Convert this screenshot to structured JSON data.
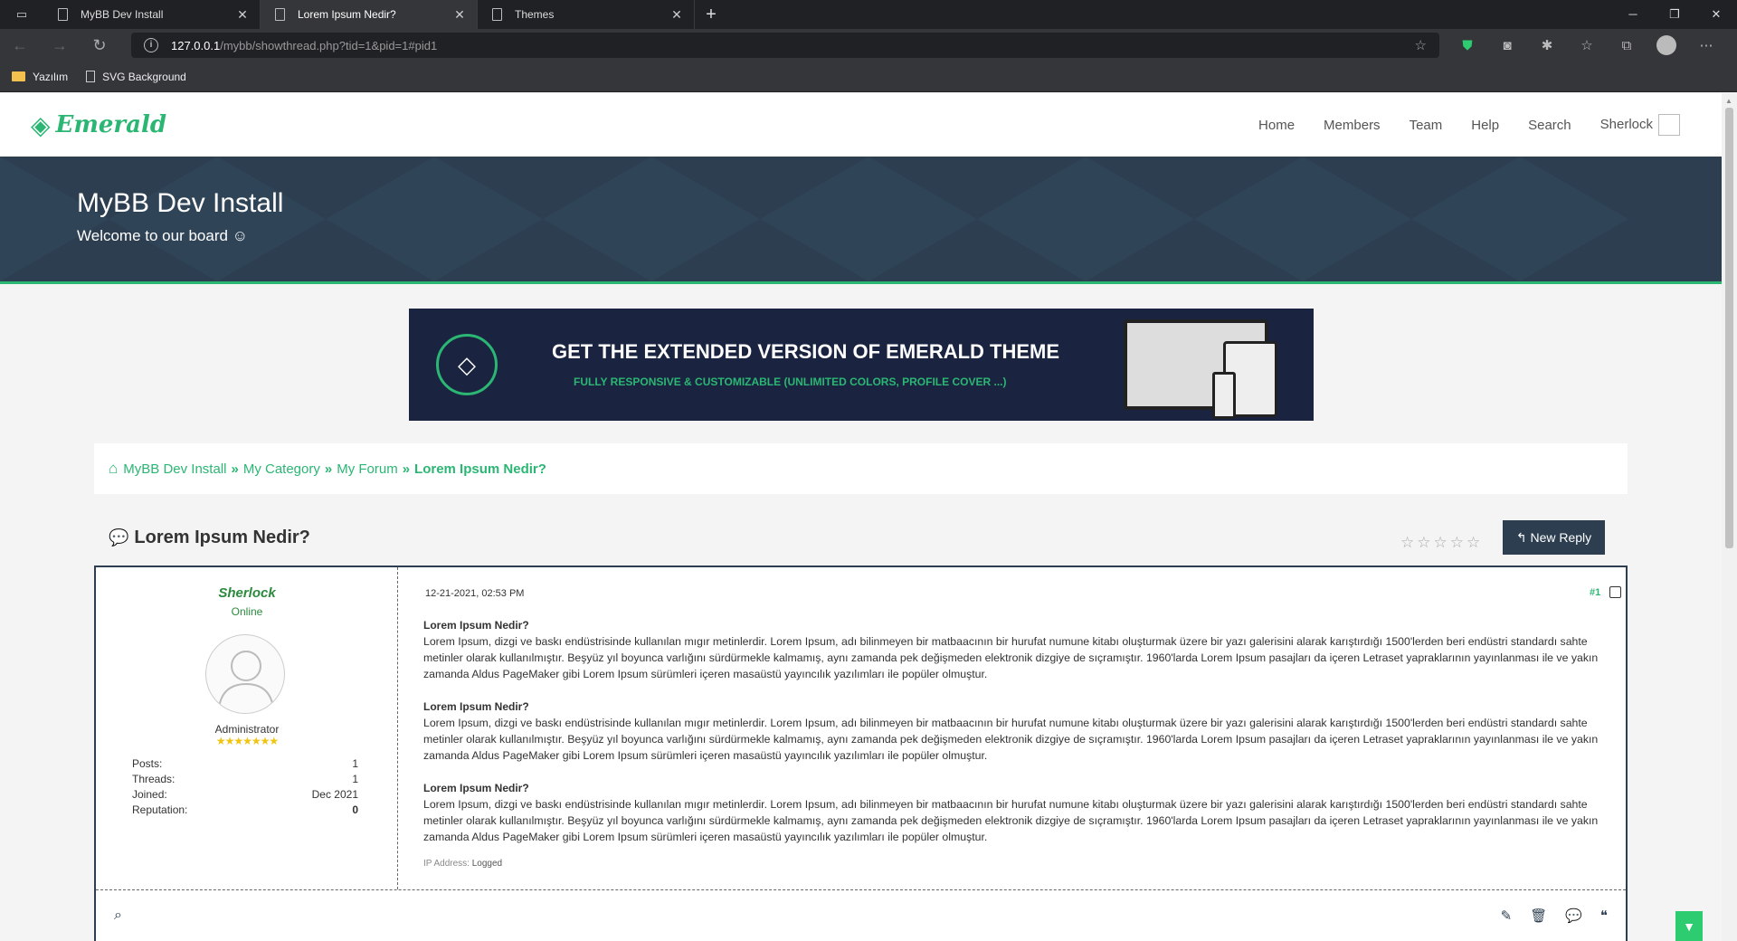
{
  "browser": {
    "tabs": [
      {
        "label": "MyBB Dev Install",
        "active": false
      },
      {
        "label": "Lorem Ipsum Nedir?",
        "active": true
      },
      {
        "label": "Themes",
        "active": false
      }
    ],
    "url_host": "127.0.0.1",
    "url_path": "/mybb/showthread.php?tid=1&pid=1#pid1",
    "bookmarks": [
      {
        "label": "Yazılım",
        "icon": "folder-icon"
      },
      {
        "label": "SVG Background",
        "icon": "page-icon"
      }
    ]
  },
  "site": {
    "logo_text": "Emerald",
    "menu": [
      "Home",
      "Members",
      "Team",
      "Help",
      "Search",
      "Sherlock"
    ],
    "hero_title": "MyBB Dev Install",
    "hero_subtitle": "Welcome to our board ☺",
    "banner_title": "GET THE EXTENDED VERSION OF EMERALD THEME",
    "banner_subtitle": "FULLY RESPONSIVE & CUSTOMIZABLE (UNLIMITED COLORS, PROFILE COVER ...)",
    "breadcrumb": [
      "MyBB Dev Install",
      "My Category",
      "My Forum",
      "Lorem Ipsum Nedir?"
    ],
    "thread_title": "Lorem Ipsum Nedir?",
    "new_reply_label": "New Reply",
    "rating_stars": 5
  },
  "post": {
    "author": "Sherlock",
    "status": "Online",
    "group": "Administrator",
    "stats": [
      {
        "label": "Posts:",
        "value": "1"
      },
      {
        "label": "Threads:",
        "value": "1"
      },
      {
        "label": "Joined:",
        "value": "Dec 2021"
      },
      {
        "label": "Reputation:",
        "value": "0"
      }
    ],
    "date": "12-21-2021, 02:53 PM",
    "number": "#1",
    "paragraphs": [
      {
        "heading": "Lorem Ipsum Nedir?",
        "text": "Lorem Ipsum, dizgi ve baskı endüstrisinde kullanılan mıgır metinlerdir. Lorem Ipsum, adı bilinmeyen bir matbaacının bir hurufat numune kitabı oluşturmak üzere bir yazı galerisini alarak karıştırdığı 1500'lerden beri endüstri standardı sahte metinler olarak kullanılmıştır. Beşyüz yıl boyunca varlığını sürdürmekle kalmamış, aynı zamanda pek değişmeden elektronik dizgiye de sıçramıştır. 1960'larda Lorem Ipsum pasajları da içeren Letraset yapraklarının yayınlanması ile ve yakın zamanda Aldus PageMaker gibi Lorem Ipsum sürümleri içeren masaüstü yayıncılık yazılımları ile popüler olmuştur."
      },
      {
        "heading": "Lorem Ipsum Nedir?",
        "text": "Lorem Ipsum, dizgi ve baskı endüstrisinde kullanılan mıgır metinlerdir. Lorem Ipsum, adı bilinmeyen bir matbaacının bir hurufat numune kitabı oluşturmak üzere bir yazı galerisini alarak karıştırdığı 1500'lerden beri endüstri standardı sahte metinler olarak kullanılmıştır. Beşyüz yıl boyunca varlığını sürdürmekle kalmamış, aynı zamanda pek değişmeden elektronik dizgiye de sıçramıştır. 1960'larda Lorem Ipsum pasajları da içeren Letraset yapraklarının yayınlanması ile ve yakın zamanda Aldus PageMaker gibi Lorem Ipsum sürümleri içeren masaüstü yayıncılık yazılımları ile popüler olmuştur."
      },
      {
        "heading": "Lorem Ipsum Nedir?",
        "text": "Lorem Ipsum, dizgi ve baskı endüstrisinde kullanılan mıgır metinlerdir. Lorem Ipsum, adı bilinmeyen bir matbaacının bir hurufat numune kitabı oluşturmak üzere bir yazı galerisini alarak karıştırdığı 1500'lerden beri endüstri standardı sahte metinler olarak kullanılmıştır. Beşyüz yıl boyunca varlığını sürdürmekle kalmamış, aynı zamanda pek değişmeden elektronik dizgiye de sıçramıştır. 1960'larda Lorem Ipsum pasajları da içeren Letraset yapraklarının yayınlanması ile ve yakın zamanda Aldus PageMaker gibi Lorem Ipsum sürümleri içeren masaüstü yayıncılık yazılımları ile popüler olmuştur."
      }
    ],
    "ip_label": "IP Address:",
    "ip_value": "Logged"
  },
  "colors": {
    "accent": "#2bb673",
    "dark": "#2c3e50"
  }
}
